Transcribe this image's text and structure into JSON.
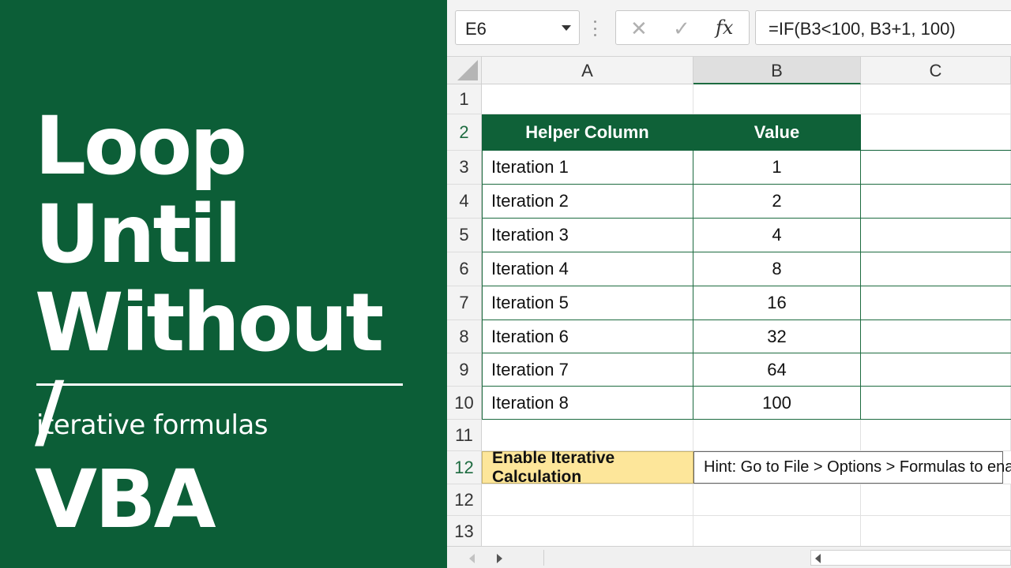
{
  "left_panel": {
    "title": "Loop Until\nWithout /\nVBA",
    "subtitle": "iterative formulas"
  },
  "formula_bar": {
    "name_box": "E6",
    "fx_label": "fx",
    "formula": "=IF(B3<100, B3+1, 100)"
  },
  "columns": [
    "A",
    "B",
    "C"
  ],
  "selected_column": "B",
  "row_numbers": [
    "1",
    "2",
    "3",
    "4",
    "5",
    "6",
    "7",
    "8",
    "9",
    "10",
    "11",
    "12",
    "12",
    "13"
  ],
  "table": {
    "headers": [
      "Helper Column",
      "Value"
    ],
    "rows": [
      {
        "label": "Iteration 1",
        "value": "1"
      },
      {
        "label": "Iteration 2",
        "value": "2"
      },
      {
        "label": "Iteration 3",
        "value": "4"
      },
      {
        "label": "Iteration 4",
        "value": "8"
      },
      {
        "label": "Iteration 5",
        "value": "16"
      },
      {
        "label": "Iteration 6",
        "value": "32"
      },
      {
        "label": "Iteration 7",
        "value": "64"
      },
      {
        "label": "Iteration 8",
        "value": "100"
      }
    ]
  },
  "tip": {
    "label": "Enable Iterative Calculation",
    "hint": "Hint: Go to File > Options > Formulas to enable."
  },
  "colors": {
    "brand_green": "#0c5e37",
    "table_header_green": "#0f6138",
    "tip_yellow": "#fde69a"
  }
}
